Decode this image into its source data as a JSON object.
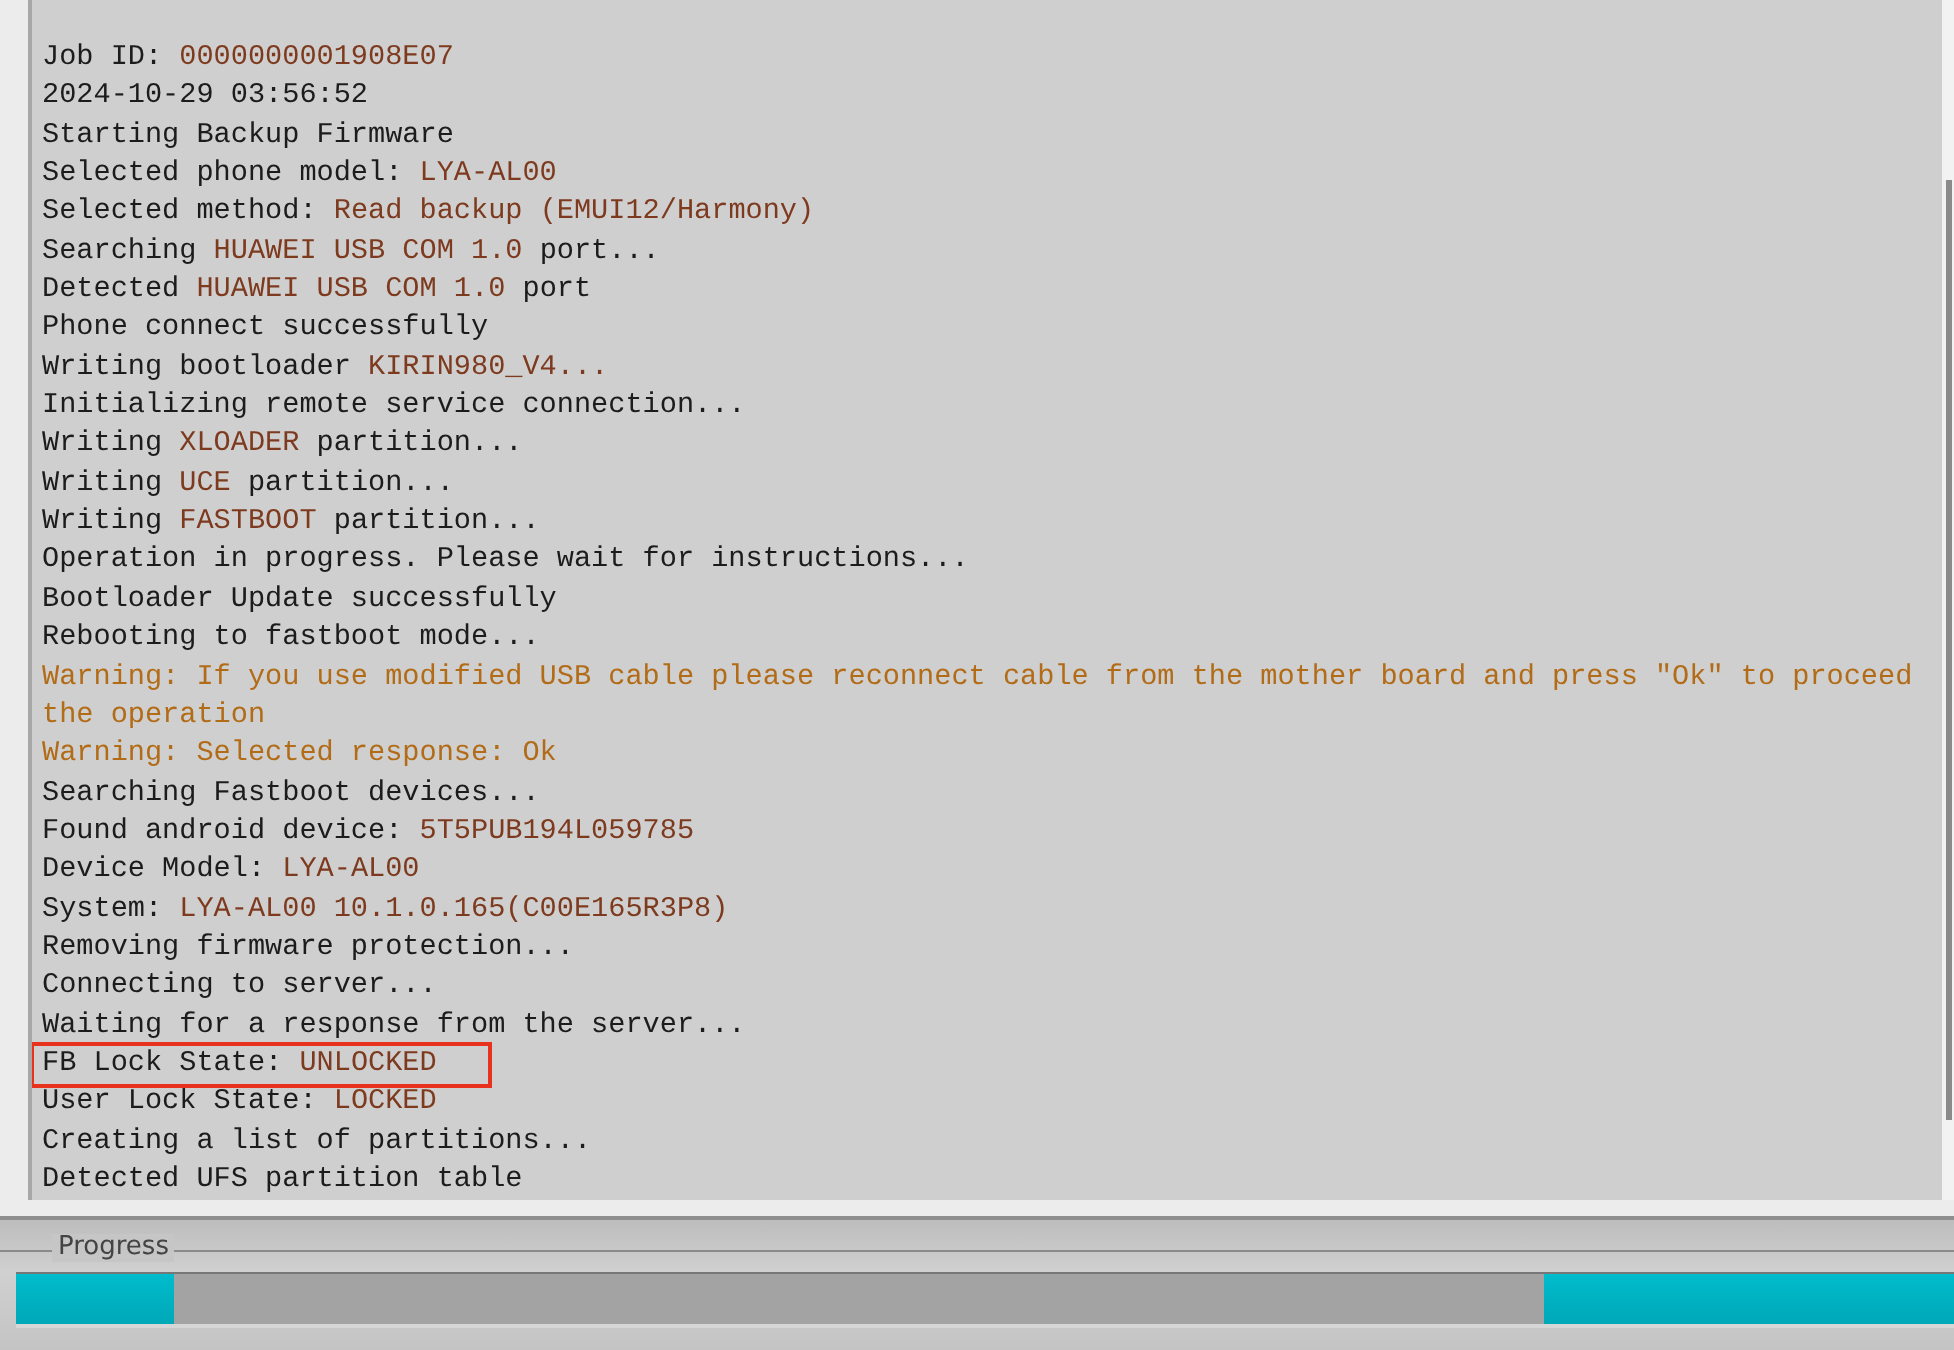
{
  "log": [
    {
      "kind": "info",
      "highlighted": false,
      "parts": [
        {
          "text": "Job ID: ",
          "value": false
        },
        {
          "text": "0000000001908E07",
          "value": true
        }
      ]
    },
    {
      "kind": "info",
      "highlighted": false,
      "parts": [
        {
          "text": "2024-10-29 03:56:52",
          "value": false
        }
      ]
    },
    {
      "kind": "info",
      "highlighted": false,
      "parts": [
        {
          "text": "Starting Backup Firmware",
          "value": false
        }
      ]
    },
    {
      "kind": "info",
      "highlighted": false,
      "parts": [
        {
          "text": "Selected phone model: ",
          "value": false
        },
        {
          "text": "LYA-AL00",
          "value": true
        }
      ]
    },
    {
      "kind": "info",
      "highlighted": false,
      "parts": [
        {
          "text": "Selected method: ",
          "value": false
        },
        {
          "text": "Read backup (EMUI12/Harmony)",
          "value": true
        }
      ]
    },
    {
      "kind": "info",
      "highlighted": false,
      "parts": [
        {
          "text": "Searching ",
          "value": false
        },
        {
          "text": "HUAWEI USB COM 1.0",
          "value": true
        },
        {
          "text": " port...",
          "value": false
        }
      ]
    },
    {
      "kind": "info",
      "highlighted": false,
      "parts": [
        {
          "text": "Detected ",
          "value": false
        },
        {
          "text": "HUAWEI USB COM 1.0",
          "value": true
        },
        {
          "text": " port",
          "value": false
        }
      ]
    },
    {
      "kind": "info",
      "highlighted": false,
      "parts": [
        {
          "text": "Phone connect successfully",
          "value": false
        }
      ]
    },
    {
      "kind": "info",
      "highlighted": false,
      "parts": [
        {
          "text": "Writing bootloader ",
          "value": false
        },
        {
          "text": "KIRIN980_V4...",
          "value": true
        }
      ]
    },
    {
      "kind": "info",
      "highlighted": false,
      "parts": [
        {
          "text": "Initializing remote service connection...",
          "value": false
        }
      ]
    },
    {
      "kind": "info",
      "highlighted": false,
      "parts": [
        {
          "text": "Writing ",
          "value": false
        },
        {
          "text": "XLOADER",
          "value": true
        },
        {
          "text": " partition...",
          "value": false
        }
      ]
    },
    {
      "kind": "info",
      "highlighted": false,
      "parts": [
        {
          "text": "Writing ",
          "value": false
        },
        {
          "text": "UCE",
          "value": true
        },
        {
          "text": " partition...",
          "value": false
        }
      ]
    },
    {
      "kind": "info",
      "highlighted": false,
      "parts": [
        {
          "text": "Writing ",
          "value": false
        },
        {
          "text": "FASTBOOT",
          "value": true
        },
        {
          "text": " partition...",
          "value": false
        }
      ]
    },
    {
      "kind": "info",
      "highlighted": false,
      "parts": [
        {
          "text": "Operation in progress. Please wait for instructions...",
          "value": false
        }
      ]
    },
    {
      "kind": "info",
      "highlighted": false,
      "parts": [
        {
          "text": "Bootloader Update successfully",
          "value": false
        }
      ]
    },
    {
      "kind": "info",
      "highlighted": false,
      "parts": [
        {
          "text": "Rebooting to fastboot mode...",
          "value": false
        }
      ]
    },
    {
      "kind": "warning",
      "highlighted": false,
      "parts": [
        {
          "text": "Warning: If you use modified USB cable please reconnect cable from the mother board and press \"Ok\" to proceed the operation",
          "value": false
        }
      ]
    },
    {
      "kind": "warning",
      "highlighted": false,
      "parts": [
        {
          "text": "Warning: Selected response: Ok",
          "value": false
        }
      ]
    },
    {
      "kind": "info",
      "highlighted": false,
      "parts": [
        {
          "text": "Searching Fastboot devices...",
          "value": false
        }
      ]
    },
    {
      "kind": "info",
      "highlighted": false,
      "parts": [
        {
          "text": "Found android device: ",
          "value": false
        },
        {
          "text": "5T5PUB194L059785",
          "value": true
        }
      ]
    },
    {
      "kind": "info",
      "highlighted": false,
      "parts": [
        {
          "text": "Device Model: ",
          "value": false
        },
        {
          "text": "LYA-AL00",
          "value": true
        }
      ]
    },
    {
      "kind": "info",
      "highlighted": false,
      "parts": [
        {
          "text": "System: ",
          "value": false
        },
        {
          "text": "LYA-AL00 10.1.0.165(C00E165R3P8)",
          "value": true
        }
      ]
    },
    {
      "kind": "info",
      "highlighted": false,
      "parts": [
        {
          "text": "Removing firmware protection...",
          "value": false
        }
      ]
    },
    {
      "kind": "info",
      "highlighted": false,
      "parts": [
        {
          "text": "Connecting to server...",
          "value": false
        }
      ]
    },
    {
      "kind": "info",
      "highlighted": false,
      "parts": [
        {
          "text": "Waiting for a response from the server...",
          "value": false
        }
      ]
    },
    {
      "kind": "info",
      "highlighted": true,
      "parts": [
        {
          "text": "FB Lock State: ",
          "value": false
        },
        {
          "text": "UNLOCKED",
          "value": true
        }
      ]
    },
    {
      "kind": "info",
      "highlighted": false,
      "parts": [
        {
          "text": "User Lock State: ",
          "value": false
        },
        {
          "text": "LOCKED",
          "value": true
        }
      ]
    },
    {
      "kind": "info",
      "highlighted": false,
      "parts": [
        {
          "text": "Creating a list of partitions...",
          "value": false
        }
      ]
    },
    {
      "kind": "info",
      "highlighted": false,
      "parts": [
        {
          "text": "Detected UFS partition table",
          "value": false
        }
      ]
    }
  ],
  "progress": {
    "label": "Progress",
    "indeterminate": true
  }
}
